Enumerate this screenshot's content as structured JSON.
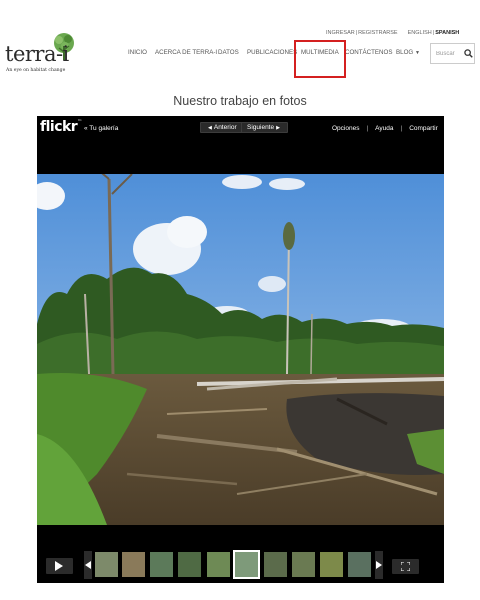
{
  "utility": {
    "login": "INGRESAR",
    "register": "REGISTRARSE",
    "english": "ENGLISH",
    "spanish": "SPANISH"
  },
  "logo": {
    "wordmark": "terra-i",
    "tagline": "An eye on habitat change"
  },
  "nav": [
    {
      "label": "INICIO"
    },
    {
      "label": "ACERCA DE TERRA-I"
    },
    {
      "label": "DATOS"
    },
    {
      "label": "PUBLICACIONES"
    },
    {
      "label": "MULTIMEDIA"
    },
    {
      "label": "CONTÁCTENOS"
    },
    {
      "label": "BLOG"
    }
  ],
  "search": {
    "placeholder": "Buscar"
  },
  "page_title": "Nuestro trabajo en fotos",
  "viewer": {
    "brand": "flickr",
    "back_label": "« Tu galería",
    "prev_label": "Anterior",
    "next_label": "Siguiente",
    "options": "Opciones",
    "help": "Ayuda",
    "share": "Compartir"
  },
  "thumbnails": {
    "count": 10,
    "selected_index": 5
  },
  "colors": {
    "highlight": "#d42020",
    "viewer_bg": "#000000"
  }
}
